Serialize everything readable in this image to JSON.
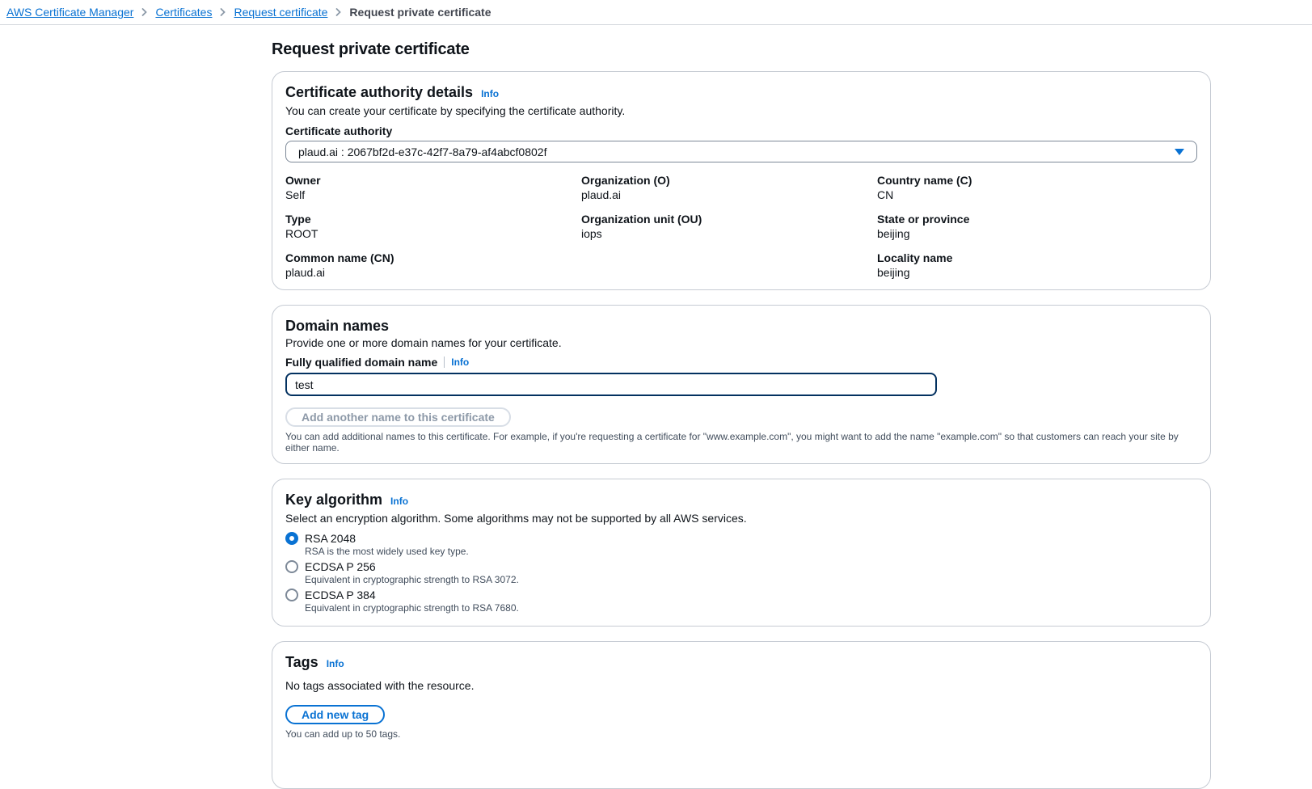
{
  "colors": {
    "accent_blue": "#0972d3",
    "input_focus_border": "#033160",
    "card_border": "#c6cbd3",
    "muted_text": "#414d5c",
    "disabled_text": "#8d99a8"
  },
  "breadcrumb": {
    "items": [
      {
        "label": "AWS Certificate Manager"
      },
      {
        "label": "Certificates"
      },
      {
        "label": "Request certificate"
      },
      {
        "label": "Request private certificate"
      }
    ]
  },
  "page": {
    "title": "Request private certificate"
  },
  "ca_card": {
    "title": "Certificate authority details",
    "info_label": "Info",
    "description": "You can create your certificate by specifying the certificate authority.",
    "select_label": "Certificate authority",
    "select_value": "plaud.ai : 2067bf2d-e37c-42f7-8a79-af4abcf0802f",
    "fields": [
      {
        "label": "Owner",
        "value": "Self"
      },
      {
        "label": "Organization (O)",
        "value": "plaud.ai"
      },
      {
        "label": "Country name (C)",
        "value": "CN"
      },
      {
        "label": "Type",
        "value": "ROOT"
      },
      {
        "label": "Organization unit (OU)",
        "value": "iops"
      },
      {
        "label": "State or province",
        "value": "beijing"
      },
      {
        "label": "Common name (CN)",
        "value": "plaud.ai"
      },
      {
        "label": "",
        "value": ""
      },
      {
        "label": "Locality name",
        "value": "beijing"
      }
    ]
  },
  "domain_card": {
    "title": "Domain names",
    "description": "Provide one or more domain names for your certificate.",
    "field_label": "Fully qualified domain name",
    "info_label": "Info",
    "input_value": "test",
    "add_button_label": "Add another name to this certificate",
    "help_text": "You can add additional names to this certificate. For example, if you're requesting a certificate for \"www.example.com\", you might want to add the name \"example.com\" so that customers can reach your site by either name."
  },
  "key_card": {
    "title": "Key algorithm",
    "info_label": "Info",
    "description": "Select an encryption algorithm. Some algorithms may not be supported by all AWS services.",
    "options": [
      {
        "label": "RSA 2048",
        "description": "RSA is the most widely used key type.",
        "selected": true
      },
      {
        "label": "ECDSA P 256",
        "description": "Equivalent in cryptographic strength to RSA 3072.",
        "selected": false
      },
      {
        "label": "ECDSA P 384",
        "description": "Equivalent in cryptographic strength to RSA 7680.",
        "selected": false
      }
    ]
  },
  "tags_card": {
    "title": "Tags",
    "info_label": "Info",
    "empty_text": "No tags associated with the resource.",
    "add_button_label": "Add new tag",
    "help_text": "You can add up to 50 tags."
  }
}
